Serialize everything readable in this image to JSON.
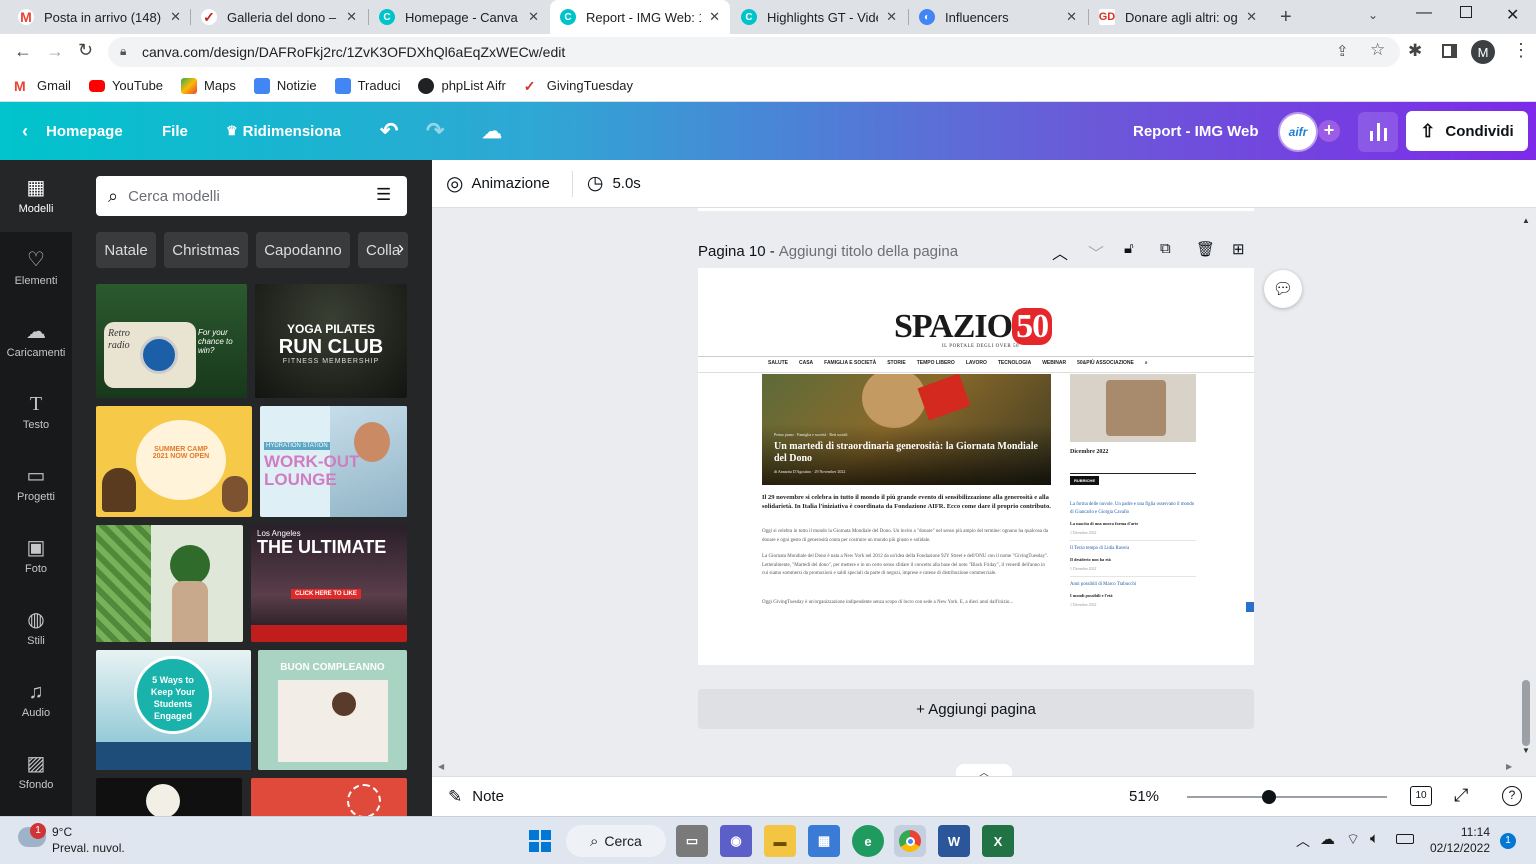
{
  "browser": {
    "tabs": [
      {
        "title": "Posta in arrivo (148) -",
        "icon": "gmail-icon",
        "color": "#ea4335"
      },
      {
        "title": "Galleria del dono – Gi",
        "icon": "gift-icon",
        "color": "#c5221f"
      },
      {
        "title": "Homepage - Canva",
        "icon": "canva-icon",
        "color": "#00c4cc"
      },
      {
        "title": "Report - IMG Web: 11",
        "icon": "canva-icon",
        "color": "#00c4cc",
        "active": true
      },
      {
        "title": "Highlights GT - Video",
        "icon": "canva-icon",
        "color": "#00c4cc"
      },
      {
        "title": "Influencers",
        "icon": "influencers-icon",
        "color": "#4285f4"
      },
      {
        "title": "Donare agli altri: oggi",
        "icon": "donare-icon",
        "color": "#d93025"
      }
    ],
    "url": "canva.com/design/DAFRoFkj2rc/1ZvK3OFDXhQl6aEqZxWECw/edit",
    "bookmarks": [
      {
        "label": "Gmail",
        "color": "#ea4335"
      },
      {
        "label": "YouTube",
        "color": "#ff0000"
      },
      {
        "label": "Maps",
        "color": "#34a853"
      },
      {
        "label": "Notizie",
        "color": "#4285f4"
      },
      {
        "label": "Traduci",
        "color": "#4285f4"
      },
      {
        "label": "phpList Aifr",
        "color": "#202124"
      },
      {
        "label": "GivingTuesday",
        "color": "#d93025"
      }
    ],
    "profile_initial": "M"
  },
  "canva": {
    "header": {
      "home": "Homepage",
      "file": "File",
      "resize": "Ridimensiona",
      "design_title": "Report - IMG Web",
      "avatar": "aifr",
      "share": "Condividi"
    },
    "rail": [
      "Modelli",
      "Elementi",
      "Caricamenti",
      "Testo",
      "Progetti",
      "Foto",
      "Stili",
      "Audio",
      "Sfondo"
    ],
    "search_placeholder": "Cerca modelli",
    "chips": [
      "Natale",
      "Christmas",
      "Capodanno",
      "Colla"
    ],
    "thumbs": {
      "radio_a": "Retro",
      "radio_b": "radio",
      "radio_c": "For your chance to win?",
      "yoga_a": "YOGA PILATES",
      "yoga_b": "RUN CLUB",
      "yoga_c": "FITNESS MEMBERSHIP",
      "camp": "SUMMER CAMP 2021 NOW OPEN",
      "lounge_a": "HYDRATION STATION",
      "lounge_b": "WORK-OUT",
      "lounge_c": "LOUNGE",
      "ultimate_a": "Los Angeles",
      "ultimate_b": "THE ULTIMATE",
      "ultimate_c": "CLICK HERE TO LIKE",
      "ways": "5 Ways to Keep Your Students Engaged",
      "birthday": "BUON COMPLEANNO"
    },
    "toolbar": {
      "animation": "Animazione",
      "duration": "5.0s"
    },
    "page": {
      "number": "Pagina 10 -",
      "title_placeholder": "Aggiungi titolo della pagina"
    },
    "add_page": "+ Aggiungi pagina",
    "notes": "Note",
    "zoom": "51%",
    "zoom_level": 0.41,
    "page_count": "10"
  },
  "article": {
    "logo": "SPAZIO",
    "logo_num": "50",
    "tagline": "IL PORTALE DEGLI OVER 50",
    "nav": [
      "SALUTE",
      "CASA",
      "FAMIGLIA E SOCIETÀ",
      "STORIE",
      "TEMPO LIBERO",
      "LAVORO",
      "TECNOLOGIA",
      "WEBINAR",
      "50&PIÙ ASSOCIAZIONE"
    ],
    "breadcrumb": "Primo piano  ·  Famiglia e società  ·  Reti sociali",
    "headline": "Un martedì di straordinaria generosità: la Giornata Mondiale del Dono",
    "byline": "di Annarita D'Agostino  ·  29 November 2022",
    "lead": "Il 29 novembre si celebra in tutto il mondo il più grande evento di sensibilizzazione alla generosità e alla solidarietà. In Italia l'iniziativa è coordinata da Fondazione AIFR. Ecco come dare il proprio contributo.",
    "p1": "Oggi si celebra in tutto il mondo la Giornata Mondiale del Dono. Un invito a \"donare\" nel senso più ampio del termine: ognuno ha qualcosa da donare e ogni gesto di generosità conta per costruire un mondo più giusto e solidale.",
    "p2": "La Giornata Mondiale del Dono è nata a New York nel 2012 da un'idea della Fondazione 92Y Street e dell'ONU con il nome \"GivingTuesday\". Letteralmente, \"Martedì del dono\", per mettere e in un certo senso sfidare il concetto alla base del noto \"Black Friday\", il venerdì dell'anno in cui siamo sommersi da promozioni e saldi speciali da parte di negozi, imprese e catene di distribuzione commerciale.",
    "p3": "Oggi GivingTuesday è un'organizzazione indipendente senza scopo di lucro con sede a New York. E, a dieci anni dall'inizio...",
    "side_date": "Dicembre 2022",
    "side_head": "RUBRICHE",
    "side_items": [
      {
        "link": "La forma delle nuvole. Un padre e una figlia osservano il mondo di Giancarlo e Giorgia Cavallo",
        "title": "La nascita di una nuova forma d'arte",
        "date": "1 Dicembre 2022"
      },
      {
        "link": "Il Terzo tempo di Lidia Ravera",
        "title": "Il desiderio non ha età",
        "date": "1 Dicembre 2022"
      },
      {
        "link": "Anni possibili di Marco Trabucchi",
        "title": "I mondi possibili e l'età",
        "date": "1 Dicembre 2022"
      }
    ]
  },
  "taskbar": {
    "weather_temp": "9°C",
    "weather_desc": "Preval. nuvol.",
    "weather_badge": "1",
    "search": "Cerca",
    "time": "11:14",
    "date": "02/12/2022",
    "notif": "1"
  }
}
